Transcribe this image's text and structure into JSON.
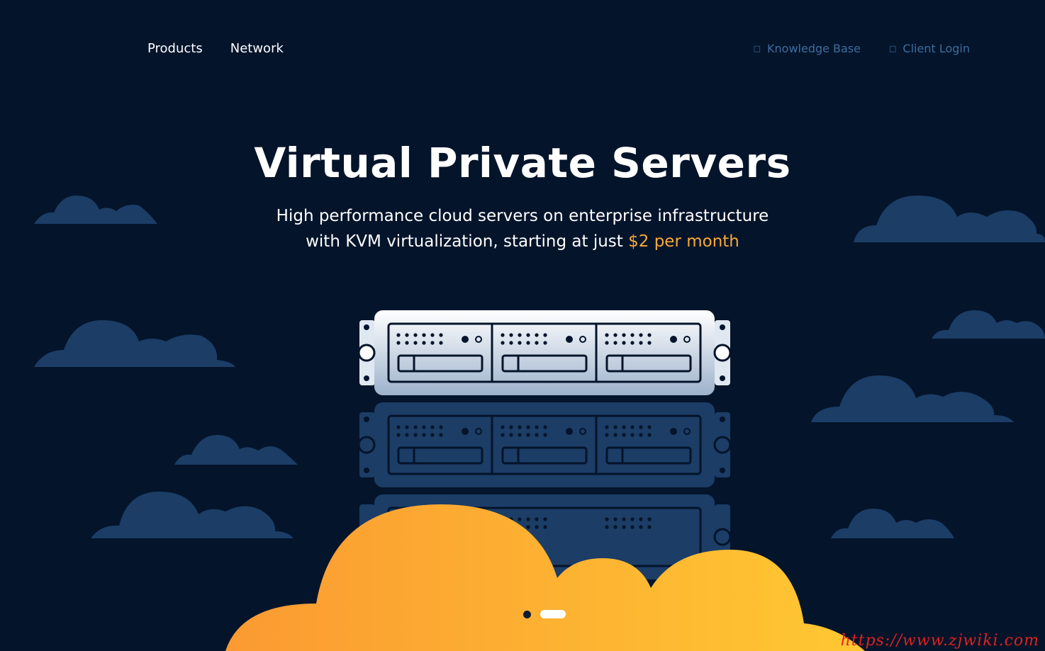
{
  "nav": {
    "left": [
      {
        "label": "Products"
      },
      {
        "label": "Network"
      }
    ],
    "right": [
      {
        "label": "Knowledge Base",
        "icon": "book-icon"
      },
      {
        "label": "Client Login",
        "icon": "user-icon"
      }
    ]
  },
  "hero": {
    "title": "Virtual Private Servers",
    "subtitle_line1": "High performance cloud servers on enterprise infrastructure",
    "subtitle_line2_prefix": "with KVM virtualization, starting at just ",
    "subtitle_price": "$2 per month"
  },
  "slider": {
    "active_index": 1,
    "count": 2
  },
  "watermark": "https://www.zjwiki.com",
  "colors": {
    "background": "#04142a",
    "accent": "#f6a93a",
    "cloud_dark": "#1b3d66",
    "nav_muted": "#3d6da0"
  }
}
